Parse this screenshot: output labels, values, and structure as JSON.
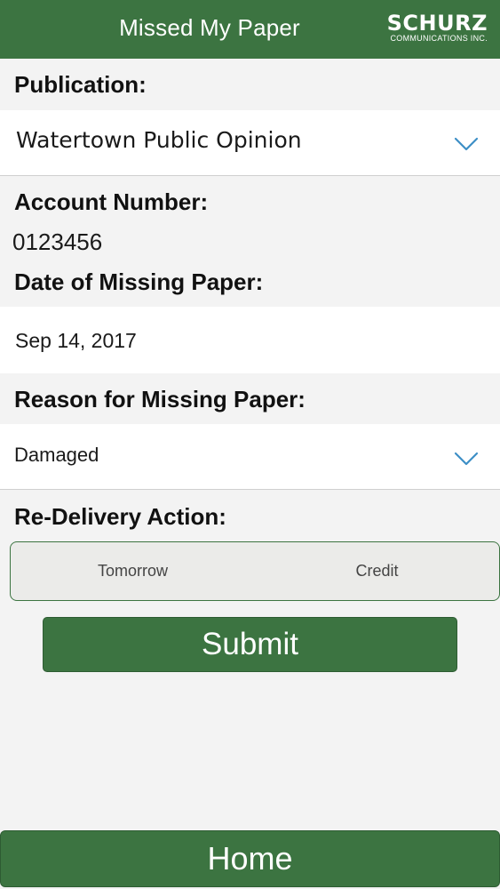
{
  "header": {
    "title": "Missed My Paper",
    "logo_main": "SCHURZ",
    "logo_sub": "COMMUNICATIONS INC."
  },
  "form": {
    "publication_label": "Publication:",
    "publication_value": "Watertown Public Opinion",
    "account_label": "Account Number:",
    "account_value": "0123456",
    "date_label": "Date of Missing Paper:",
    "date_value": "Sep 14, 2017",
    "reason_label": "Reason for Missing Paper:",
    "reason_value": "Damaged",
    "redelivery_label": "Re-Delivery Action:",
    "redelivery_options": [
      "Tomorrow",
      "Credit"
    ],
    "submit_label": "Submit"
  },
  "footer": {
    "home_label": "Home"
  },
  "colors": {
    "brand_green": "#3c7441",
    "chevron_blue": "#3d8fc6"
  },
  "icons": {
    "dropdown": "chevron-down-icon"
  }
}
